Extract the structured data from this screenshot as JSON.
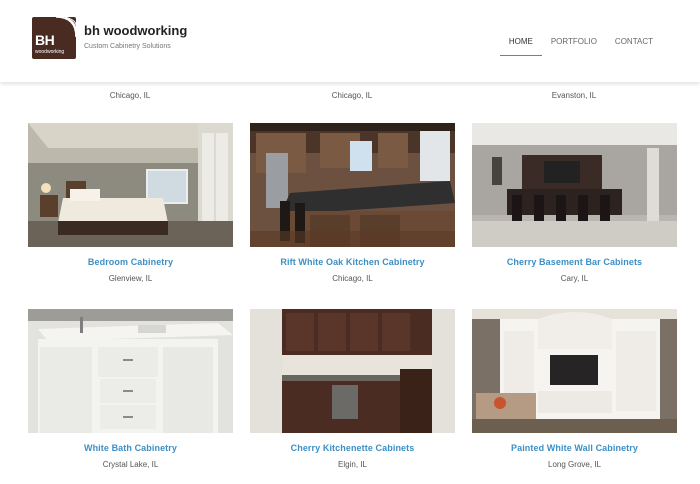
{
  "header": {
    "logo_mark": "BH",
    "logo_sub": "woodworking",
    "brand_name": "bh woodworking",
    "tagline": "Custom Cabinetry Solutions",
    "nav": [
      {
        "label": "HOME",
        "active": true
      },
      {
        "label": "PORTFOLIO",
        "active": false
      },
      {
        "label": "CONTACT",
        "active": false
      }
    ]
  },
  "gallery": {
    "top_row_locations": [
      "Chicago, IL",
      "Chicago, IL",
      "Evanston, IL"
    ],
    "items": [
      {
        "title": "Bedroom Cabinetry",
        "location": "Glenview, IL",
        "image": "bedroom"
      },
      {
        "title": "Rift White Oak Kitchen Cabinetry",
        "location": "Chicago, IL",
        "image": "kitchen"
      },
      {
        "title": "Cherry Basement Bar Cabinets",
        "location": "Cary, IL",
        "image": "bar"
      },
      {
        "title": "White Bath Cabinetry",
        "location": "Crystal Lake, IL",
        "image": "bath"
      },
      {
        "title": "Cherry Kitchenette Cabinets",
        "location": "Elgin, IL",
        "image": "kitchenette"
      },
      {
        "title": "Painted White Wall Cabinetry",
        "location": "Long Grove, IL",
        "image": "wallunit"
      }
    ]
  },
  "colors": {
    "accent": "#3d8fc4",
    "logo_bg": "#4a2b22"
  }
}
